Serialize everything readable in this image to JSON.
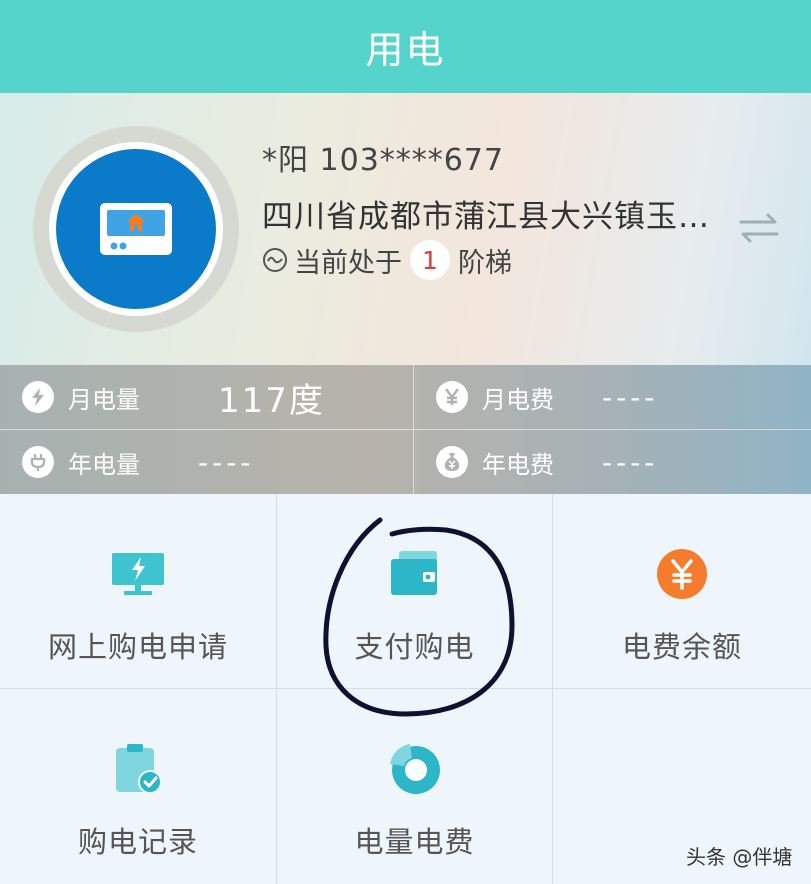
{
  "header": {
    "title": "用电"
  },
  "account": {
    "user": "*阳  103****677",
    "address": "四川省成都市蒲江县大兴镇玉…",
    "tier_prefix": "当前处于",
    "tier_value": "1",
    "tier_suffix": "阶梯"
  },
  "stats": {
    "monthly_usage": {
      "label": "月电量",
      "value": "117度"
    },
    "monthly_fee": {
      "label": "月电费",
      "value": "----"
    },
    "yearly_usage": {
      "label": "年电量",
      "value": "----"
    },
    "yearly_fee": {
      "label": "年电费",
      "value": "----"
    }
  },
  "menu": [
    {
      "label": "网上购电申请",
      "icon": "monitor-lightning-icon"
    },
    {
      "label": "支付购电",
      "icon": "wallet-icon"
    },
    {
      "label": "电费余额",
      "icon": "yen-coin-icon"
    },
    {
      "label": "购电记录",
      "icon": "clipboard-check-icon"
    },
    {
      "label": "电量电费",
      "icon": "pie-chart-icon"
    }
  ],
  "watermark": "头条 @伴塘",
  "colors": {
    "header": "#55d4cc",
    "accent_blue": "#0b7ac8",
    "orange": "#f57c2c",
    "teal_icon": "#3ec3cf",
    "badge_red": "#e53935"
  }
}
